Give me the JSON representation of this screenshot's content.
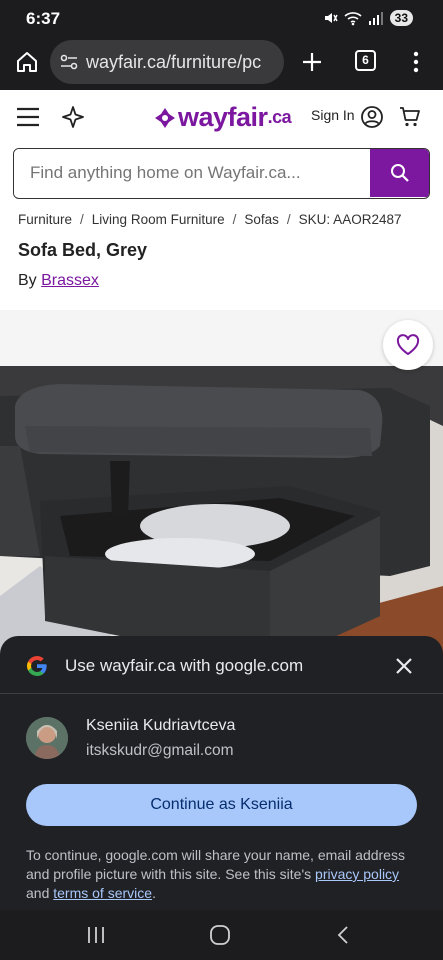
{
  "status_bar": {
    "time": "6:37",
    "battery": "33"
  },
  "browser": {
    "url": "wayfair.ca/furniture/pc",
    "tab_count": "6"
  },
  "site": {
    "logo": "wayfair",
    "logo_suffix": ".ca",
    "sign_in": "Sign In",
    "search_placeholder": "Find anything home on Wayfair.ca..."
  },
  "breadcrumb": {
    "items": [
      "Furniture",
      "Living Room Furniture",
      "Sofas"
    ],
    "separator": "/",
    "sku": "SKU: AAOR2487"
  },
  "product": {
    "title": "Sofa Bed, Grey",
    "by": "By",
    "brand": "Brassex"
  },
  "google_sheet": {
    "title": "Use wayfair.ca with google.com",
    "account_name": "Kseniia Kudriavtceva",
    "account_email": "itskskudr@gmail.com",
    "continue_label": "Continue as Kseniia",
    "disclaimer_text": "To continue, google.com will share your name, email address and profile picture with this site. See this site's",
    "privacy_link": "privacy policy",
    "and_text": "and",
    "terms_link": "terms of service",
    "period": "."
  },
  "colors": {
    "brand": "#7b189f",
    "sheet_bg": "#202124",
    "continue_button": "#a8c7fa"
  }
}
